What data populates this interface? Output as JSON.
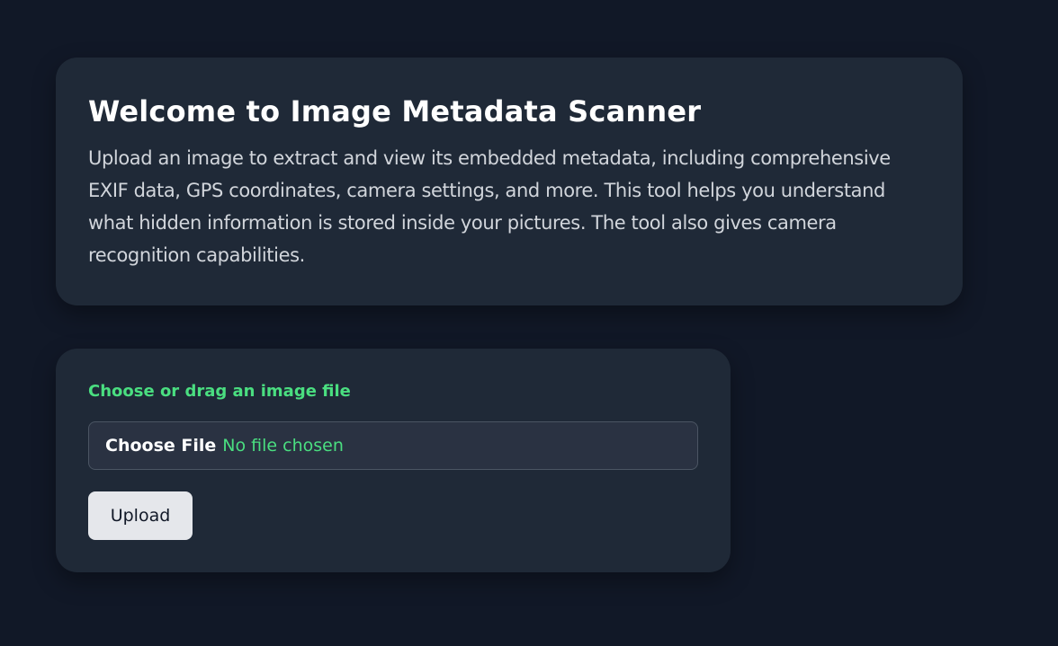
{
  "intro": {
    "title": "Welcome to Image Metadata Scanner",
    "description": "Upload an image to extract and view its embedded metadata, including comprehensive EXIF data, GPS coordinates, camera settings, and more. This tool helps you understand what hidden information is stored inside your pictures. The tool also gives camera recognition capabilities."
  },
  "upload": {
    "label": "Choose or drag an image file",
    "choose_button": "Choose File",
    "file_status": "No file chosen",
    "upload_button": "Upload"
  },
  "colors": {
    "background": "#111827",
    "card": "#1f2937",
    "accent": "#4ade80",
    "button": "#e5e7eb"
  }
}
